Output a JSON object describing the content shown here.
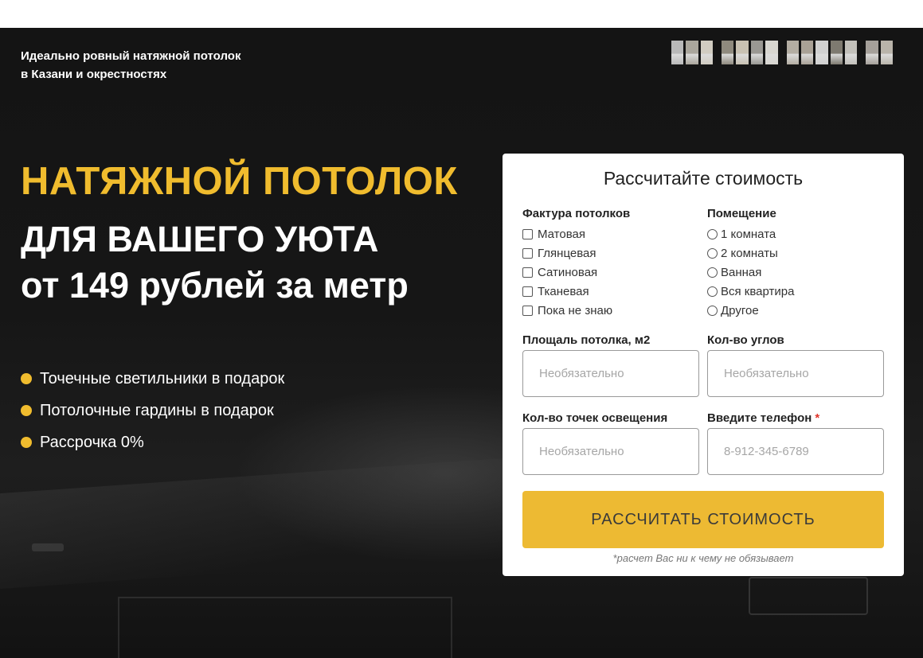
{
  "header": {
    "tagline_line1": "Идеально ровный натяжной потолок",
    "tagline_line2": "в Казани и окрестностях",
    "phone_blur_colors": [
      "#b9b9b9",
      "#aaa69c",
      "#d1ccc1",
      "#8f8a7e",
      "#c8c1b2",
      "#9a9893",
      "#d8d6d0",
      "#b3ada2",
      "#a9a196",
      "#d0d0d0",
      "#7e7a70",
      "#c2c0ba",
      "#a5a09a",
      "#b9b4aa"
    ]
  },
  "hero": {
    "headline_yellow": "НАТЯЖНОЙ ПОТОЛОК",
    "headline_line2": "ДЛЯ ВАШЕГО УЮТА",
    "headline_line3": "от 149 рублей за метр",
    "accent_color": "#f0bc2e",
    "bullets": [
      "Точечные светильники в подарок",
      "Потолочные гардины в подарок",
      "Рассрочка 0%"
    ]
  },
  "form": {
    "title": "Рассчитайте стоимость",
    "texture": {
      "label": "Фактура потолков",
      "options": [
        "Матовая",
        "Глянцевая",
        "Сатиновая",
        "Тканевая",
        "Пока не знаю"
      ]
    },
    "room": {
      "label": "Помещение",
      "options": [
        "1 комната",
        "2 комнаты",
        "Ванная",
        "Вся квартира",
        "Другое"
      ]
    },
    "area": {
      "label": "Площаль потолка, м2",
      "placeholder": "Необязательно"
    },
    "corners": {
      "label": "Кол-во углов",
      "placeholder": "Необязательно"
    },
    "lights": {
      "label": "Кол-во точек освещения",
      "placeholder": "Необязательно"
    },
    "phone": {
      "label": "Введите телефон",
      "required_mark": "*",
      "placeholder": "8-912-345-6789"
    },
    "submit_label": "РАССЧИТАТЬ СТОИМОСТЬ",
    "note": "*расчет Вас ни к чему не обязывает",
    "button_color": "#edba33"
  }
}
